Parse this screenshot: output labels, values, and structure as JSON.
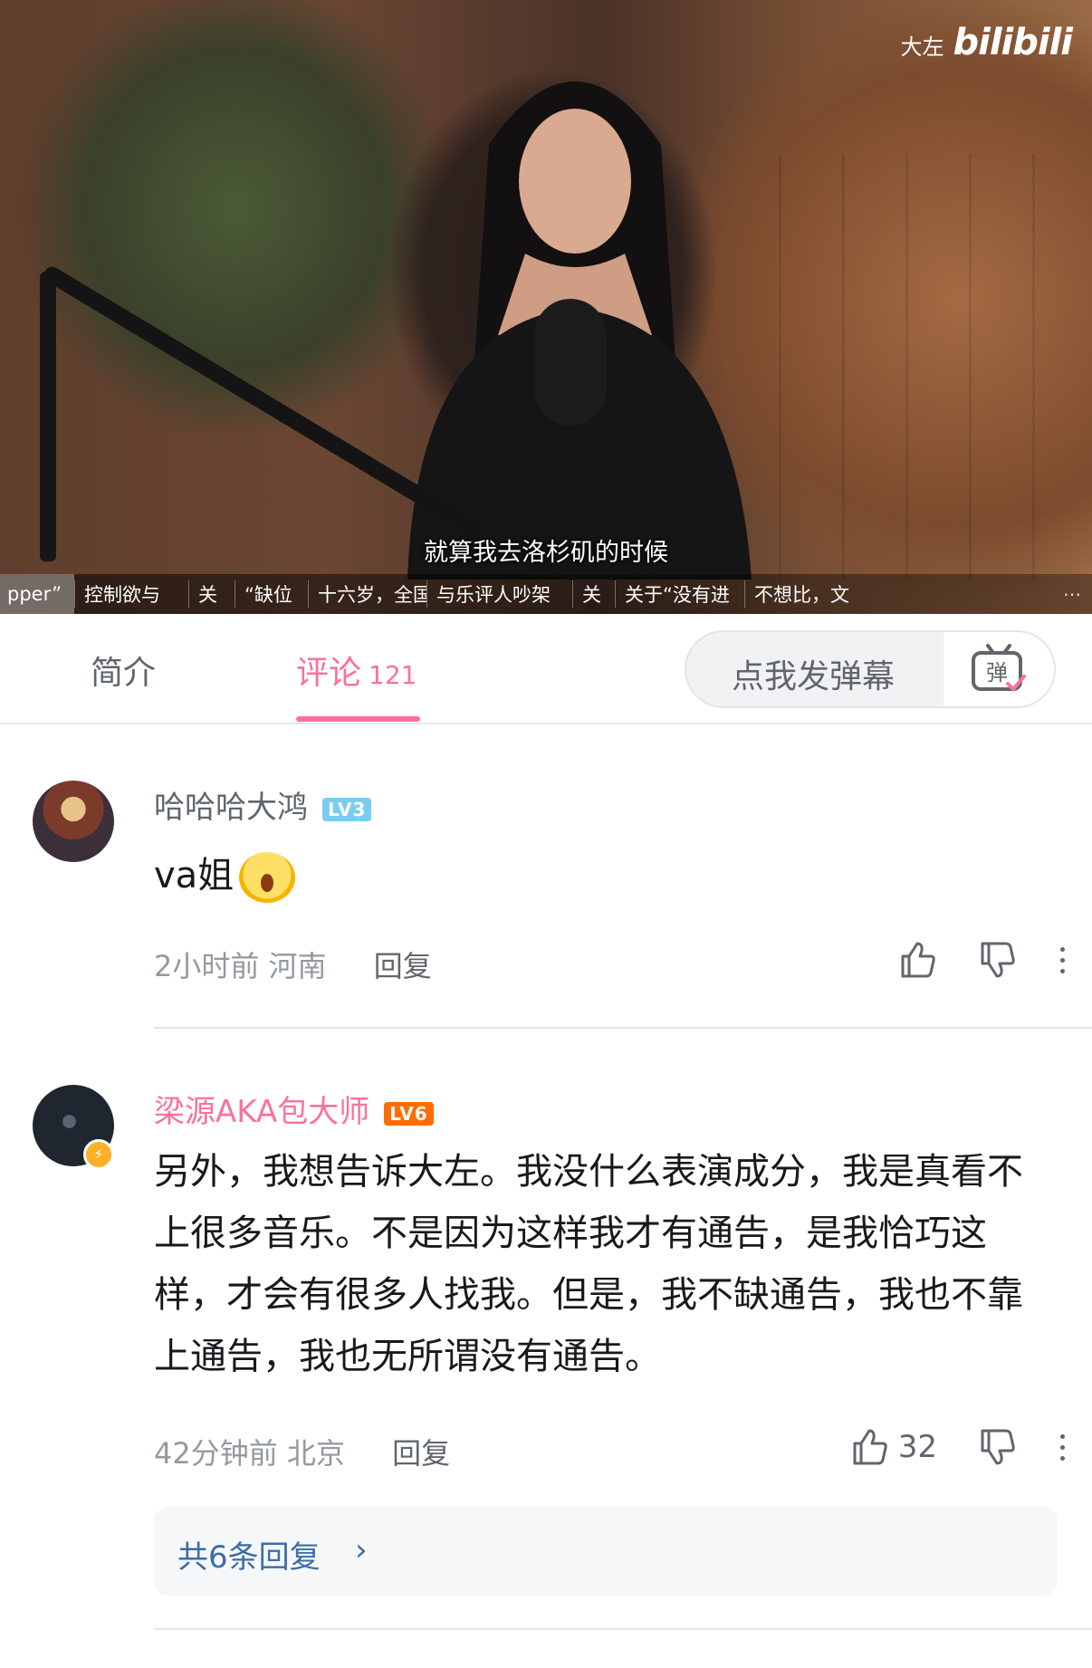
{
  "video": {
    "watermark_author": "大左",
    "watermark_logo": "bilibili",
    "subtitle": "就算我去洛杉矶的时候",
    "chapters": [
      "pper”",
      "控制欲与",
      "关",
      "“缺位",
      "十六岁，全国",
      "与乐评人吵架",
      "关",
      "关于“没有进",
      "不想比，文"
    ]
  },
  "tabs": {
    "intro_label": "简介",
    "comments_label": "评论",
    "comments_count": "121",
    "danmaku_placeholder": "点我发弹幕",
    "danmaku_icon_label": "弹"
  },
  "comments": [
    {
      "username": "哈哈哈大鸿",
      "level": "LV3",
      "content": "va姐",
      "emoji": "shocked-face-emoji",
      "time": "2小时前",
      "location": "河南",
      "reply_label": "回复",
      "likes": ""
    },
    {
      "username": "梁源AKA包大师",
      "level": "LV6",
      "content": "另外，我想告诉大左。我没什么表演成分，我是真看不上很多音乐。不是因为这样我才有通告，是我恰巧这样，才会有很多人找我。但是，我不缺通告，我也不靠上通告，我也无所谓没有通告。",
      "time": "42分钟前",
      "location": "北京",
      "reply_label": "回复",
      "likes": "32",
      "replies_label": "共6条回复"
    }
  ],
  "colors": {
    "accent": "#fb7299",
    "text_primary": "#18191c",
    "text_secondary": "#61666d",
    "text_muted": "#9499a0",
    "reply_link": "#3a6ea5",
    "level3": "#7bcdef",
    "level6": "#ff6c00"
  },
  "icons": [
    "thumb-up-icon",
    "thumb-down-icon",
    "more-vertical-icon",
    "danmaku-tv-icon",
    "chevron-right-icon",
    "verified-badge-icon"
  ]
}
